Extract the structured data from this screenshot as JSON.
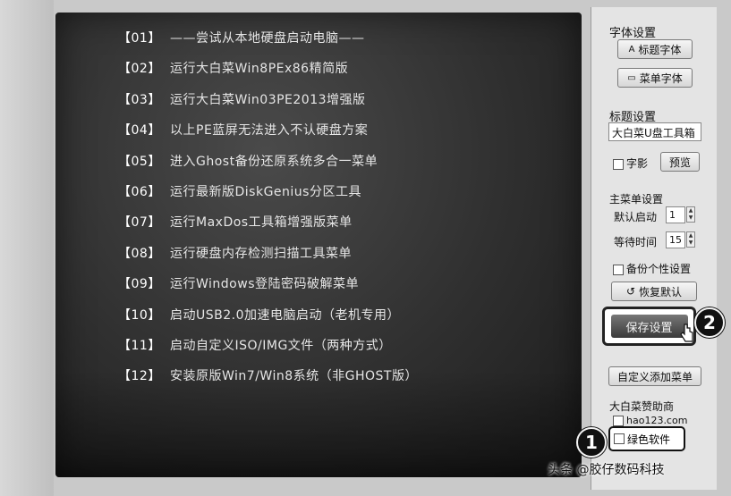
{
  "menu": {
    "items": [
      {
        "num": "【01】",
        "label": "——尝试从本地硬盘启动电脑——"
      },
      {
        "num": "【02】",
        "label": "运行大白菜Win8PEx86精简版"
      },
      {
        "num": "【03】",
        "label": "运行大白菜Win03PE2013增强版"
      },
      {
        "num": "【04】",
        "label": "以上PE蓝屏无法进入不认硬盘方案"
      },
      {
        "num": "【05】",
        "label": "进入Ghost备份还原系统多合一菜单"
      },
      {
        "num": "【06】",
        "label": "运行最新版DiskGenius分区工具"
      },
      {
        "num": "【07】",
        "label": "运行MaxDos工具箱增强版菜单"
      },
      {
        "num": "【08】",
        "label": "运行硬盘内存检测扫描工具菜单"
      },
      {
        "num": "【09】",
        "label": "运行Windows登陆密码破解菜单"
      },
      {
        "num": "【10】",
        "label": "启动USB2.0加速电脑启动（老机专用）"
      },
      {
        "num": "【11】",
        "label": "启动自定义ISO/IMG文件（两种方式）"
      },
      {
        "num": "【12】",
        "label": "安装原版Win7/Win8系统（非GHOST版）"
      }
    ]
  },
  "panel": {
    "font_settings": "字体设置",
    "title_font_btn": "标题字体",
    "menu_font_btn": "菜单字体",
    "title_settings": "标题设置",
    "title_value": "大白菜U盘工具箱",
    "shadow_label": "字影",
    "preview_btn": "预览",
    "main_menu_settings": "主菜单设置",
    "default_boot_label": "默认启动",
    "default_boot_value": "1",
    "wait_time_label": "等待时间",
    "wait_time_value": "15",
    "backup_label": "备份个性设置",
    "restore_btn": "恢复默认",
    "save_btn": "保存设置",
    "custom_add_btn": "自定义添加菜单",
    "sponsor_title": "大白菜赞助商",
    "sponsor_site": "hao123.com",
    "green_software": "绿色软件"
  },
  "badges": {
    "one": "1",
    "two": "2"
  },
  "watermark": "头条 @胶仔数码科技"
}
